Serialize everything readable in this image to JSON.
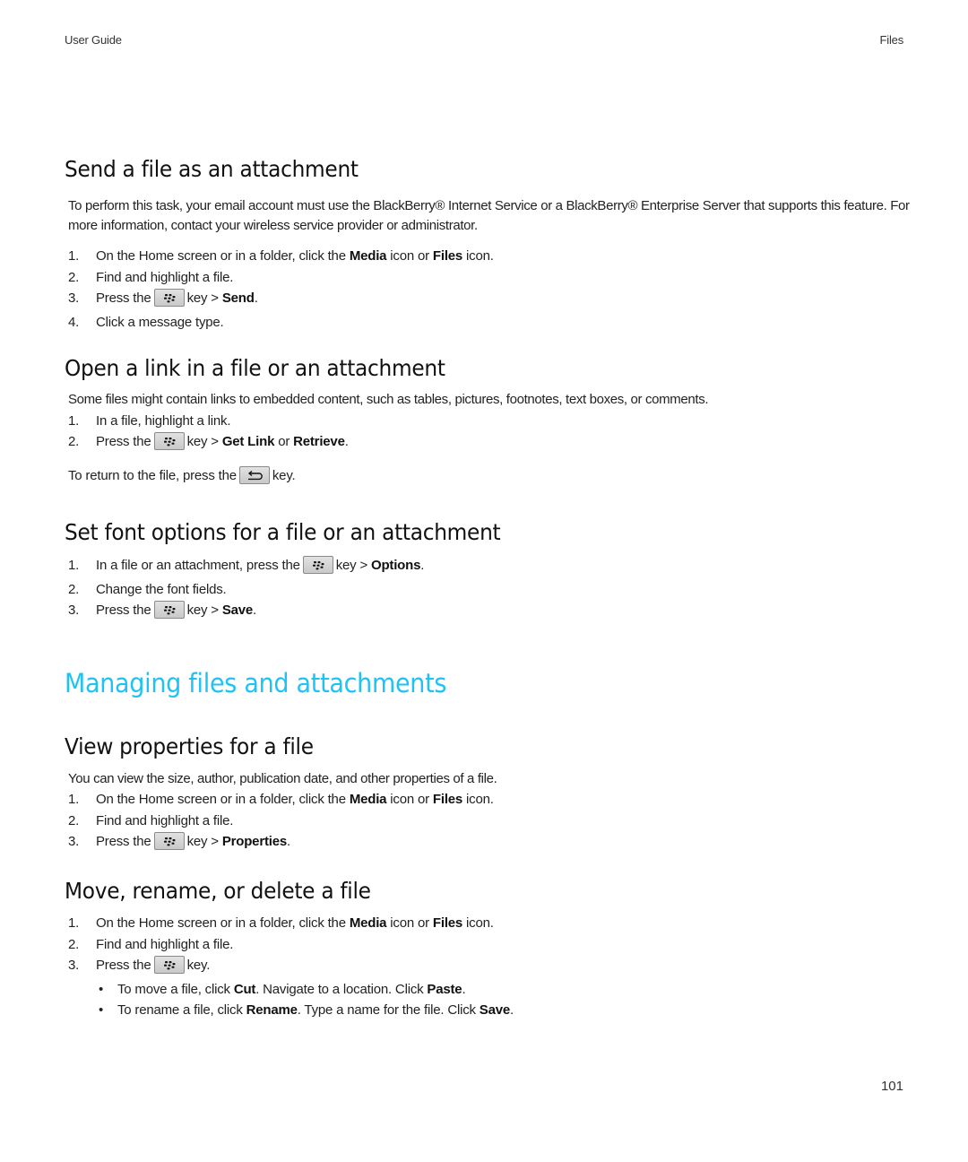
{
  "header": {
    "left": "User Guide",
    "right": "Files"
  },
  "page_number": "101",
  "colors": {
    "chapter_heading": "#1fc2f4",
    "body_text": "#222222"
  },
  "sections": {
    "send": {
      "title": "Send a file as an attachment",
      "intro": "To perform this task, your email account must use the BlackBerry® Internet Service or a BlackBerry® Enterprise Server that supports this feature. For more information, contact your wireless service provider or administrator.",
      "steps": [
        {
          "num": "1.",
          "pre": "On the Home screen or in a folder, click the ",
          "b1": "Media",
          "mid": " icon or ",
          "b2": "Files",
          "post": " icon."
        },
        {
          "num": "2.",
          "text": "Find and highlight a file."
        },
        {
          "num": "3.",
          "pre": "Press the",
          "key_icon": "blackberry-menu-key-icon",
          "mid": "key > ",
          "b1": "Send",
          "post": "."
        },
        {
          "num": "4.",
          "text": "Click a message type."
        }
      ]
    },
    "open_link": {
      "title": "Open a link in a file or an attachment",
      "intro": "Some files might contain links to embedded content, such as tables, pictures, footnotes, text boxes, or comments.",
      "steps": [
        {
          "num": "1.",
          "text": "In a file, highlight a link."
        },
        {
          "num": "2.",
          "pre": "Press the",
          "key_icon": "blackberry-menu-key-icon",
          "mid": "key > ",
          "b1": "Get Link",
          "mid2": " or ",
          "b2": "Retrieve",
          "post": "."
        }
      ],
      "note": {
        "pre": "To return to the file, press the",
        "key_icon": "escape-back-key-icon",
        "post": "key."
      }
    },
    "font_options": {
      "title": "Set font options for a file or an attachment",
      "steps": [
        {
          "num": "1.",
          "pre": "In a file or an attachment, press the",
          "key_icon": "blackberry-menu-key-icon",
          "mid": "key > ",
          "b1": "Options",
          "post": "."
        },
        {
          "num": "2.",
          "text": "Change the font fields."
        },
        {
          "num": "3.",
          "pre": "Press the",
          "key_icon": "blackberry-menu-key-icon",
          "mid": "key > ",
          "b1": "Save",
          "post": "."
        }
      ]
    },
    "chapter": {
      "title": "Managing files and attachments"
    },
    "view_properties": {
      "title": "View properties for a file",
      "intro": "You can view the size, author, publication date, and other properties of a file.",
      "steps": [
        {
          "num": "1.",
          "pre": "On the Home screen or in a folder, click the ",
          "b1": "Media",
          "mid": " icon or ",
          "b2": "Files",
          "post": " icon."
        },
        {
          "num": "2.",
          "text": "Find and highlight a file."
        },
        {
          "num": "3.",
          "pre": "Press the",
          "key_icon": "blackberry-menu-key-icon",
          "mid": "key > ",
          "b1": "Properties",
          "post": "."
        }
      ]
    },
    "move_rename": {
      "title": "Move, rename, or delete a file",
      "steps": [
        {
          "num": "1.",
          "pre": "On the Home screen or in a folder, click the ",
          "b1": "Media",
          "mid": " icon or ",
          "b2": "Files",
          "post": " icon."
        },
        {
          "num": "2.",
          "text": "Find and highlight a file."
        },
        {
          "num": "3.",
          "pre": "Press the",
          "key_icon": "blackberry-menu-key-icon",
          "post": "key."
        }
      ],
      "bullets": [
        {
          "dot": "•",
          "pre": "To move a file, click ",
          "b1": "Cut",
          "mid": ". Navigate to a location. Click ",
          "b2": "Paste",
          "post": "."
        },
        {
          "dot": "•",
          "pre": "To rename a file, click ",
          "b1": "Rename",
          "mid": ". Type a name for the file. Click ",
          "b2": "Save",
          "post": "."
        }
      ]
    }
  }
}
